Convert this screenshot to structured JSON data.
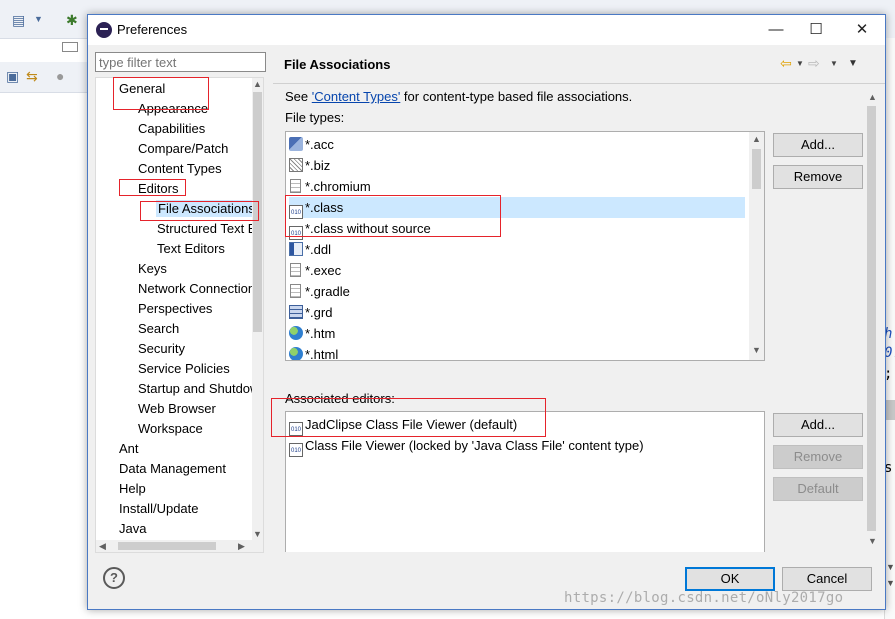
{
  "dialog": {
    "title": "Preferences",
    "window_controls": {
      "minimize": "—",
      "maximize": "☐",
      "close": "✕"
    }
  },
  "filter": {
    "placeholder": "type filter text"
  },
  "tree": {
    "items": [
      {
        "label": "General",
        "level": 0
      },
      {
        "label": "Appearance",
        "level": 1
      },
      {
        "label": "Capabilities",
        "level": 1
      },
      {
        "label": "Compare/Patch",
        "level": 1
      },
      {
        "label": "Content Types",
        "level": 1
      },
      {
        "label": "Editors",
        "level": 1
      },
      {
        "label": "File Associations",
        "level": 2,
        "selected": true
      },
      {
        "label": "Structured Text Editors",
        "level": 2
      },
      {
        "label": "Text Editors",
        "level": 2
      },
      {
        "label": "Keys",
        "level": 1
      },
      {
        "label": "Network Connections",
        "level": 1
      },
      {
        "label": "Perspectives",
        "level": 1
      },
      {
        "label": "Search",
        "level": 1
      },
      {
        "label": "Security",
        "level": 1
      },
      {
        "label": "Service Policies",
        "level": 1
      },
      {
        "label": "Startup and Shutdown",
        "level": 1
      },
      {
        "label": "Web Browser",
        "level": 1
      },
      {
        "label": "Workspace",
        "level": 1
      },
      {
        "label": "Ant",
        "level": 0
      },
      {
        "label": "Data Management",
        "level": 0
      },
      {
        "label": "Help",
        "level": 0
      },
      {
        "label": "Install/Update",
        "level": 0
      },
      {
        "label": "Java",
        "level": 0
      }
    ]
  },
  "page": {
    "title": "File Associations",
    "intro_prefix": "See ",
    "intro_link": "'Content Types'",
    "intro_suffix": " for content-type based file associations.",
    "file_types_label": "File types:",
    "file_types": [
      {
        "name": "*.acc",
        "icon": "acc-file-icon"
      },
      {
        "name": "*.biz",
        "icon": "biz-file-icon"
      },
      {
        "name": "*.chromium",
        "icon": "text-file-icon"
      },
      {
        "name": "*.class",
        "icon": "class-file-icon",
        "selected": true
      },
      {
        "name": "*.class without source",
        "icon": "class-file-icon"
      },
      {
        "name": "*.ddl",
        "icon": "ddl-file-icon"
      },
      {
        "name": "*.exec",
        "icon": "text-file-icon"
      },
      {
        "name": "*.gradle",
        "icon": "text-file-icon"
      },
      {
        "name": "*.grd",
        "icon": "grd-file-icon"
      },
      {
        "name": "*.htm",
        "icon": "web-file-icon"
      },
      {
        "name": "*.html",
        "icon": "web-file-icon"
      }
    ],
    "file_type_buttons": {
      "add": "Add...",
      "remove": "Remove"
    },
    "editors_label": "Associated editors:",
    "editors": [
      {
        "name": "JadClipse Class File Viewer (default)",
        "icon": "class-file-icon"
      },
      {
        "name": "Class File Viewer (locked by 'Java Class File' content type)",
        "icon": "class-file-icon"
      }
    ],
    "editor_buttons": {
      "add": "Add...",
      "remove": "Remove",
      "default": "Default"
    }
  },
  "footer": {
    "help": "?",
    "ok": "OK",
    "cancel": "Cancel"
  },
  "watermark": "https://blog.csdn.net/oNly2017go",
  "background": {
    "code_fragments": [
      "h",
      "0.",
      ";",
      "s"
    ]
  },
  "colors": {
    "accent": "#0078d7",
    "annotation_red": "#e5232b",
    "selection": "#cce8ff"
  }
}
